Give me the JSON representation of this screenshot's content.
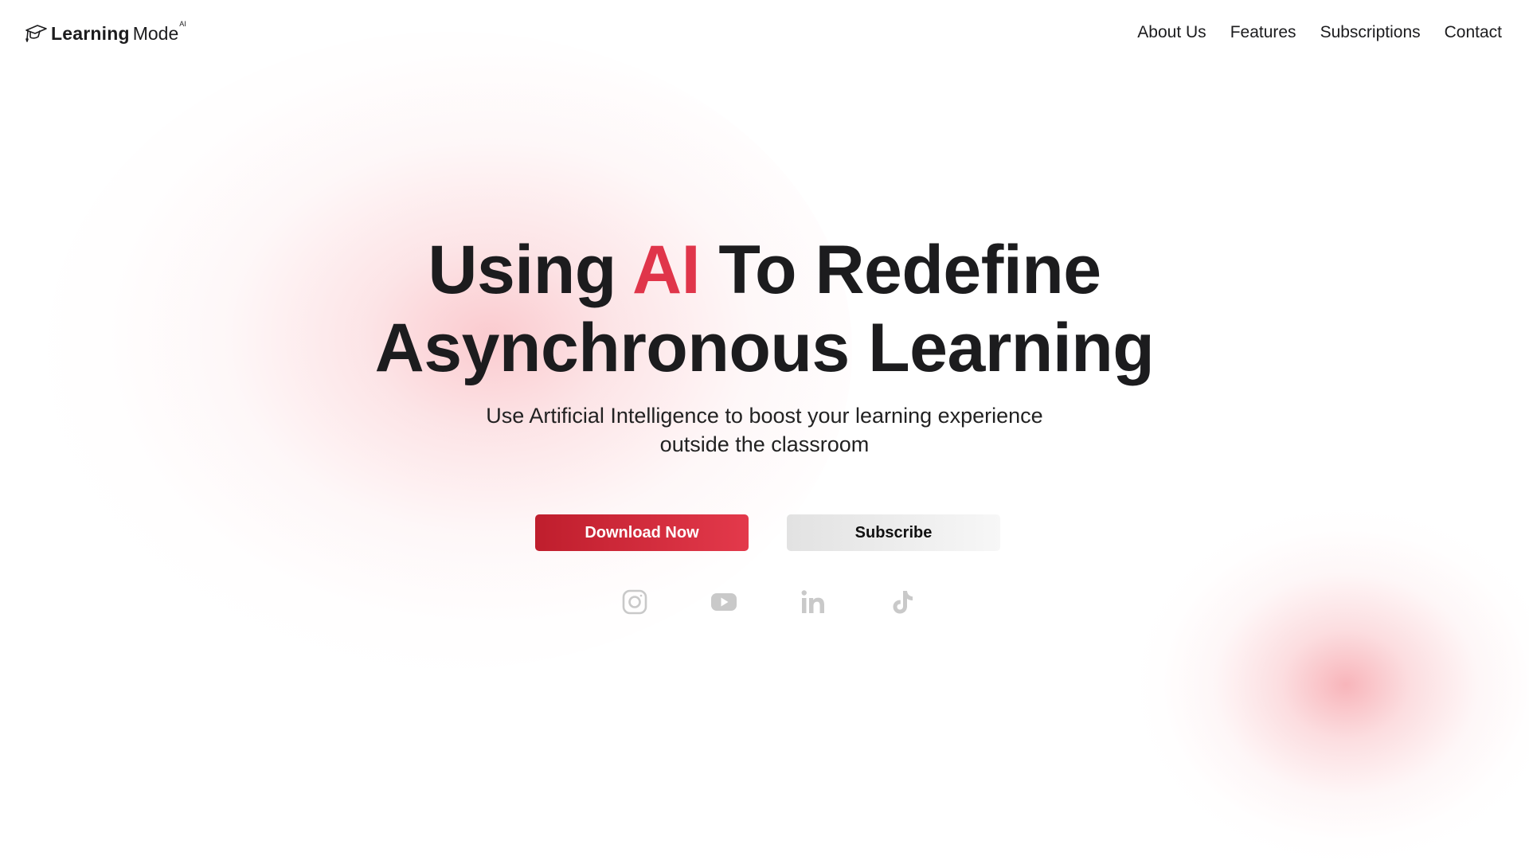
{
  "brand": {
    "name_bold": "Learning",
    "name_light": "Mode",
    "superscript": "AI",
    "icon": "graduation-cap-icon"
  },
  "nav": {
    "items": [
      {
        "label": "About Us"
      },
      {
        "label": "Features"
      },
      {
        "label": "Subscriptions"
      },
      {
        "label": "Contact"
      }
    ]
  },
  "hero": {
    "title_part1": "Using ",
    "title_accent": "AI",
    "title_part2": " To Redefine",
    "title_line2": "Asynchronous Learning",
    "subtitle": "Use Artificial Intelligence to boost your learning experience outside the classroom"
  },
  "cta": {
    "primary_label": "Download Now",
    "secondary_label": "Subscribe"
  },
  "social": [
    {
      "icon": "instagram-icon"
    },
    {
      "icon": "youtube-icon"
    },
    {
      "icon": "linkedin-icon"
    },
    {
      "icon": "tiktok-icon"
    }
  ],
  "colors": {
    "accent": "#e0354a",
    "button_primary_start": "#bf1e2d",
    "button_primary_end": "#e3394b",
    "text": "#1c1c1e",
    "social_icon": "#c9c9c9",
    "glow": "#f48a94"
  }
}
